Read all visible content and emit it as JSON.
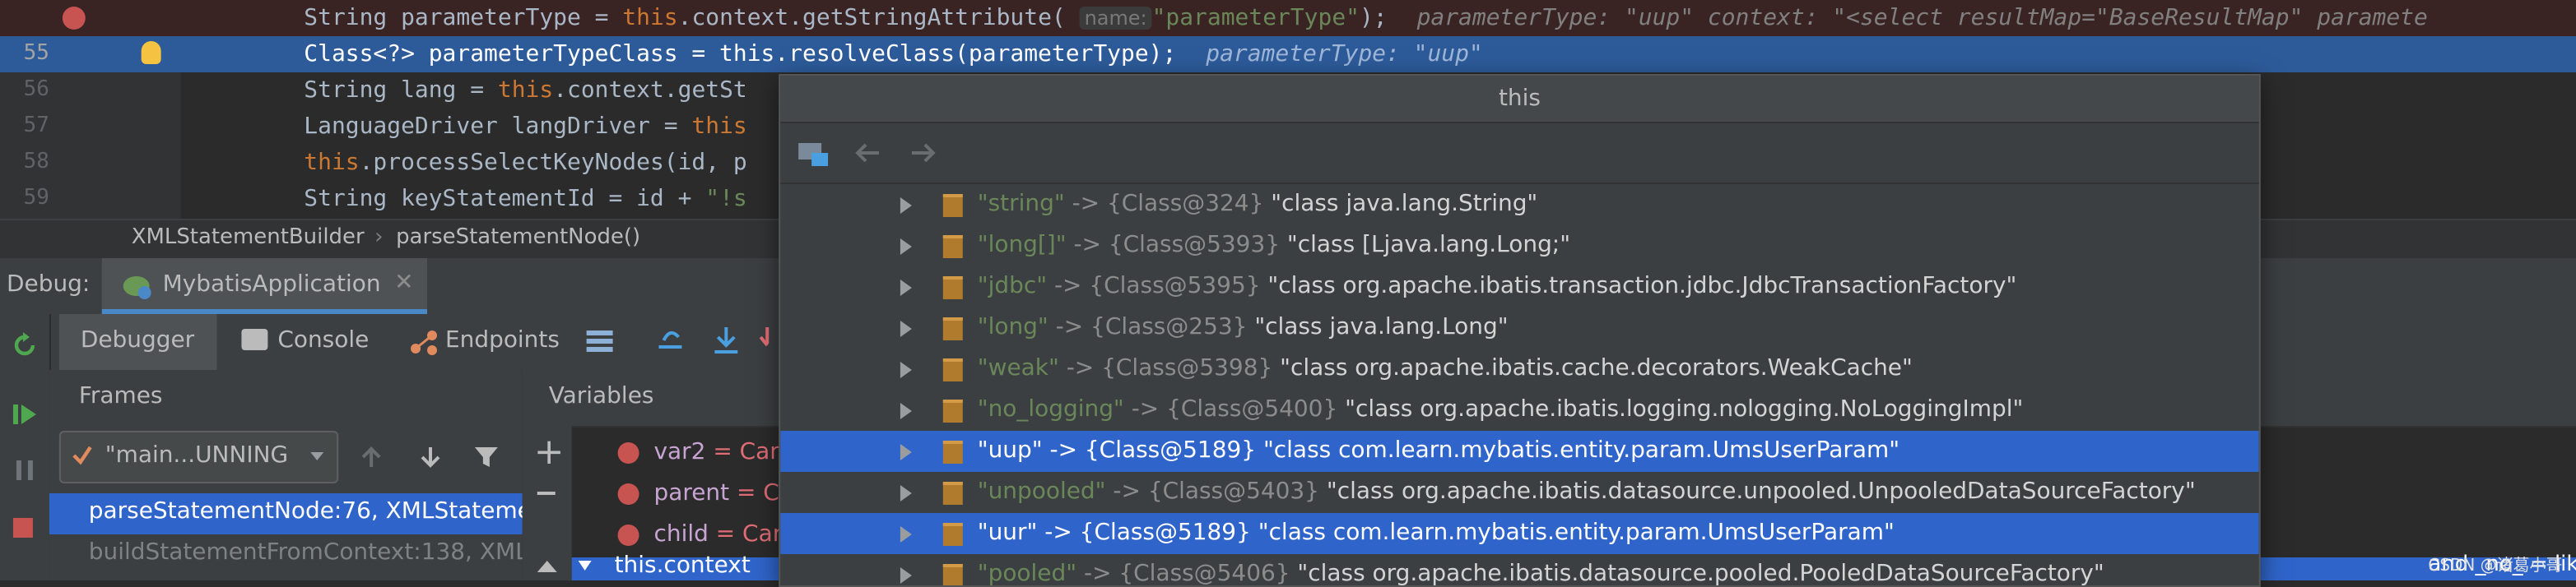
{
  "editor": {
    "lines": [
      {
        "num": "",
        "code_a": "String parameterType = ",
        "kw": "this",
        "code_b": ".context.getStringAttribute(",
        "hint": "name:",
        "str": "\"parameterType\"",
        "code_c": ");",
        "inline": "parameterType: \"uup\"  context: \"<select resultMap=\"BaseResultMap\" paramete"
      },
      {
        "num": "55",
        "code": "Class<?> parameterTypeClass = this.resolveClass(parameterType);",
        "inline": "parameterType: \"uup\""
      },
      {
        "num": "56",
        "code_a": "String lang = ",
        "kw": "this",
        "code_b": ".context.getSt"
      },
      {
        "num": "57",
        "code_a": "LanguageDriver langDriver = ",
        "kw": "this"
      },
      {
        "num": "58",
        "kw": "this",
        "code_b": ".processSelectKeyNodes(id, p"
      },
      {
        "num": "59",
        "code_a": "String keyStatementId = id + ",
        "str": "\"!s"
      }
    ],
    "breadcrumb": [
      "XMLStatementBuilder",
      "parseStatementNode()"
    ]
  },
  "debug": {
    "label": "Debug:",
    "config_tab": "MybatisApplication",
    "tabs": [
      "Debugger",
      "Console",
      "Endpoints"
    ],
    "frames_label": "Frames",
    "variables_label": "Variables",
    "thread_select": "\"main...UNNING",
    "frames": [
      "parseStatementNode:76, XMLStatemen",
      "buildStatementFromContext:138, XMLM"
    ],
    "variables": [
      {
        "name": "var2",
        "value": "= Can"
      },
      {
        "name": "parent",
        "value": "= Ca"
      },
      {
        "name": "child",
        "value": "= Car"
      },
      {
        "name": "this.context",
        "value": ""
      }
    ],
    "right_fragment": "and _no_ = like co",
    "watermark": "CSDN @诸葛小哥"
  },
  "popup": {
    "title": "this",
    "rows": [
      {
        "key": "\"string\"",
        "ref": "{Class@324}",
        "value": "\"class java.lang.String\"",
        "selected": false
      },
      {
        "key": "\"long[]\"",
        "ref": "{Class@5393}",
        "value": "\"class [Ljava.lang.Long;\"",
        "selected": false
      },
      {
        "key": "\"jdbc\"",
        "ref": "{Class@5395}",
        "value": "\"class org.apache.ibatis.transaction.jdbc.JdbcTransactionFactory\"",
        "selected": false
      },
      {
        "key": "\"long\"",
        "ref": "{Class@253}",
        "value": "\"class java.lang.Long\"",
        "selected": false
      },
      {
        "key": "\"weak\"",
        "ref": "{Class@5398}",
        "value": "\"class org.apache.ibatis.cache.decorators.WeakCache\"",
        "selected": false
      },
      {
        "key": "\"no_logging\"",
        "ref": "{Class@5400}",
        "value": "\"class org.apache.ibatis.logging.nologging.NoLoggingImpl\"",
        "selected": false
      },
      {
        "key": "\"uup\"",
        "ref": "{Class@5189}",
        "value": "\"class com.learn.mybatis.entity.param.UmsUserParam\"",
        "selected": true
      },
      {
        "key": "\"unpooled\"",
        "ref": "{Class@5403}",
        "value": "\"class org.apache.ibatis.datasource.unpooled.UnpooledDataSourceFactory\"",
        "selected": false
      },
      {
        "key": "\"uur\"",
        "ref": "{Class@5189}",
        "value": "\"class com.learn.mybatis.entity.param.UmsUserParam\"",
        "selected": true
      },
      {
        "key": "\"pooled\"",
        "ref": "{Class@5406}",
        "value": "\"class org.apache.ibatis.datasource.pooled.PooledDataSourceFactory\"",
        "selected": false
      }
    ],
    "arrow_sep": " -> "
  },
  "colors": {
    "selection": "#2f65ca",
    "editor_selection": "#2d5b9a",
    "string": "#6a8759",
    "keyword": "#cc7832"
  }
}
